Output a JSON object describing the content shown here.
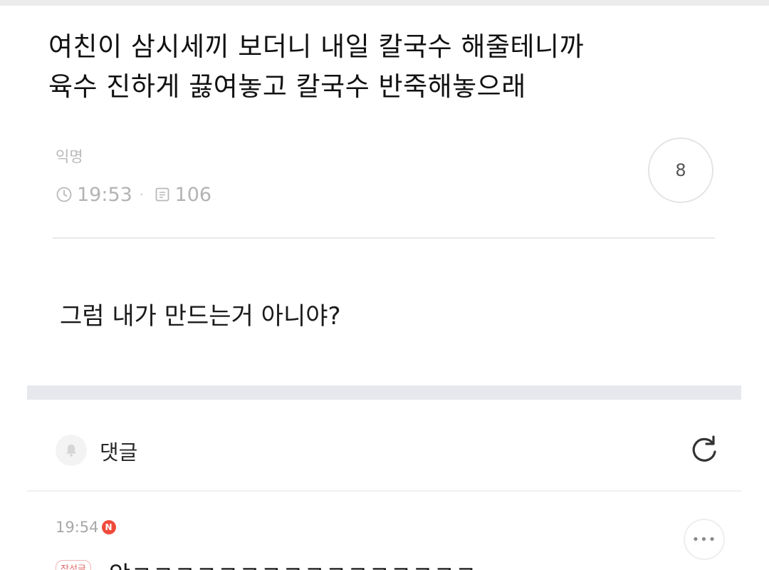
{
  "post": {
    "title_line1": "여친이 삼시세끼 보더니 내일 칼국수 해줄테니까",
    "title_line2": "육수 진하게 끓여놓고 칼국수 반죽해놓으래",
    "author": "익명",
    "time": "19:53",
    "meta_separator": "·",
    "views": "106",
    "like_count": "8",
    "body": "그럼 내가 만드는거 아니야?"
  },
  "comments_section": {
    "label": "댓글"
  },
  "comments": [
    {
      "time": "19:54",
      "new_badge": "N",
      "writer_badge": "작성글",
      "text": "앜ㅋㅋㅋㅋㅋㅋㅋㅋㅋㅋㅋㅋㅋㅋㅋㅋ",
      "more_label": "•••"
    }
  ],
  "icons": {
    "clock": "clock-icon",
    "views": "document-icon",
    "bell": "bell-icon",
    "refresh": "refresh-icon"
  },
  "colors": {
    "new_badge": "#f04a3a",
    "meta_text": "#b3b3b3",
    "section_band": "#e7e8ee"
  }
}
